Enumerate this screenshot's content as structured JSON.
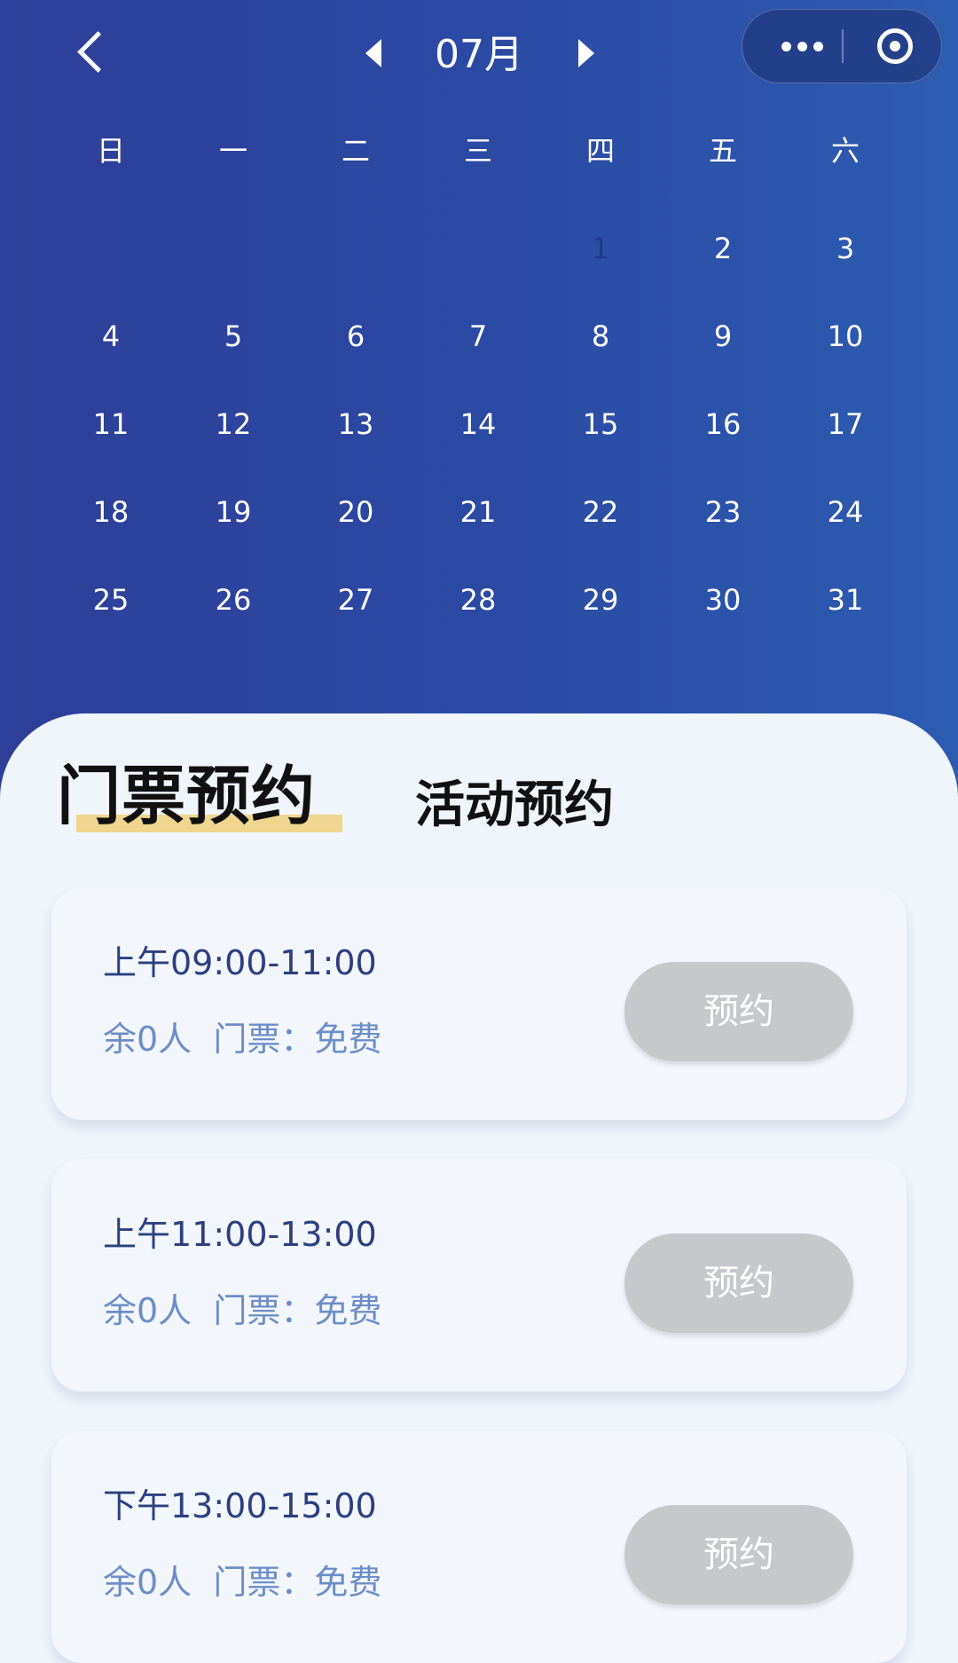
{
  "nav": {
    "month": "07月"
  },
  "calendar": {
    "weekdays": [
      "日",
      "一",
      "二",
      "三",
      "四",
      "五",
      "六"
    ],
    "selected_day": "1",
    "weeks": [
      [
        "",
        "",
        "",
        "",
        "1",
        "2",
        "3"
      ],
      [
        "4",
        "5",
        "6",
        "7",
        "8",
        "9",
        "10"
      ],
      [
        "11",
        "12",
        "13",
        "14",
        "15",
        "16",
        "17"
      ],
      [
        "18",
        "19",
        "20",
        "21",
        "22",
        "23",
        "24"
      ],
      [
        "25",
        "26",
        "27",
        "28",
        "29",
        "30",
        "31"
      ]
    ]
  },
  "tabs": {
    "ticket": "门票预约",
    "activity": "活动预约"
  },
  "slots": [
    {
      "time": "上午09:00-11:00",
      "info": "余0人  门票：免费",
      "button": "预约"
    },
    {
      "time": "上午11:00-13:00",
      "info": "余0人  门票：免费",
      "button": "预约"
    },
    {
      "time": "下午13:00-15:00",
      "info": "余0人  门票：免费",
      "button": "预约"
    }
  ],
  "colors": {
    "header_gradient_start": "#2d3f98",
    "header_gradient_end": "#2c5cb1",
    "tab_underline": "#f0d58e",
    "slot_time": "#2c4080",
    "slot_info": "#6c8ec8",
    "disabled_button": "#c6c8cc"
  }
}
